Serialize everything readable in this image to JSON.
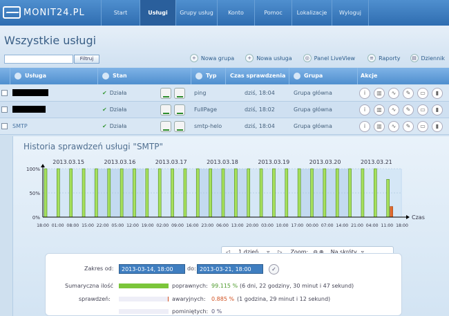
{
  "app": {
    "logo_text": "MONIT24.PL"
  },
  "nav": [
    "Start",
    "Usługi",
    "Grupy usług",
    "Konto",
    "Pomoc",
    "Lokalizacje",
    "Wyloguj"
  ],
  "nav_active": "Usługi",
  "page": {
    "title": "Wszystkie usługi"
  },
  "filter": {
    "placeholder": "",
    "button": "Filtruj"
  },
  "top_actions": [
    "Nowa grupa",
    "Nowa usługa",
    "Panel LiveView",
    "Raporty",
    "Dziennik"
  ],
  "table": {
    "headers": [
      "Usługa",
      "Stan",
      "Typ",
      "Czas sprawdzenia",
      "Grupa",
      "Akcje"
    ],
    "rows": [
      {
        "name": "",
        "redacted": true,
        "status": "Działa",
        "type": "ping",
        "time": "dziś, 18:04",
        "group": "Grupa główna"
      },
      {
        "name": "",
        "redacted": true,
        "status": "Działa",
        "type": "FullPage",
        "time": "dziś, 18:02",
        "group": "Grupa główna"
      },
      {
        "name": "SMTP",
        "redacted": false,
        "status": "Działa",
        "type": "smtp-helo",
        "time": "dziś, 18:04",
        "group": "Grupa główna"
      }
    ]
  },
  "history": {
    "title": "Historia sprawdzeń usługi \"SMTP\""
  },
  "chart_data": {
    "type": "bar",
    "dates": [
      "2013.03.15",
      "2013.03.16",
      "2013.03.17",
      "2013.03.18",
      "2013.03.19",
      "2013.03.20",
      "2013.03.21"
    ],
    "y_ticks": [
      "100%",
      "50%",
      "0%"
    ],
    "x_ticks": [
      "18:00",
      "01:00",
      "08:00",
      "15:00",
      "22:00",
      "05:00",
      "12:00",
      "19:00",
      "02:00",
      "09:00",
      "16:00",
      "23:00",
      "06:00",
      "13:00",
      "20:00",
      "03:00",
      "10:00",
      "17:00",
      "00:00",
      "07:00",
      "14:00",
      "21:00",
      "04:00",
      "11:00",
      "18:00"
    ],
    "xlabel": "Czas",
    "ylim": [
      0,
      100
    ],
    "values": [
      100,
      100,
      100,
      100,
      100,
      100,
      100,
      100,
      100,
      100,
      100,
      100,
      100,
      100,
      100,
      100,
      100,
      100,
      100,
      100,
      100,
      100,
      100,
      100,
      100,
      100,
      100,
      78
    ],
    "failure": {
      "index": 27,
      "value": 22
    },
    "colors": {
      "ok": "#a6e05c",
      "fail": "#e06a2a"
    }
  },
  "controls": {
    "period": "1 dzień",
    "zoom_label": "Zoom:",
    "shortcuts": "Na skróty"
  },
  "range": {
    "from_label": "Zakres od:",
    "from": "2013-03-14, 18:00",
    "to_label": "do:",
    "to": "2013-03-21, 18:00"
  },
  "summary": {
    "label1": "Sumaryczna ilość",
    "label2": "sprawdzeń:",
    "ok_label": "poprawnych:",
    "ok_pct": "99.115 %",
    "ok_detail": "(6 dni, 22 godziny, 30 minut i 47 sekund)",
    "fail_label": "awaryjnych:",
    "fail_pct": "0.885 %",
    "fail_detail": "(1 godzina, 29 minut i 12 sekund)",
    "skip_label": "pominiętych:",
    "skip_pct": "0 %"
  }
}
